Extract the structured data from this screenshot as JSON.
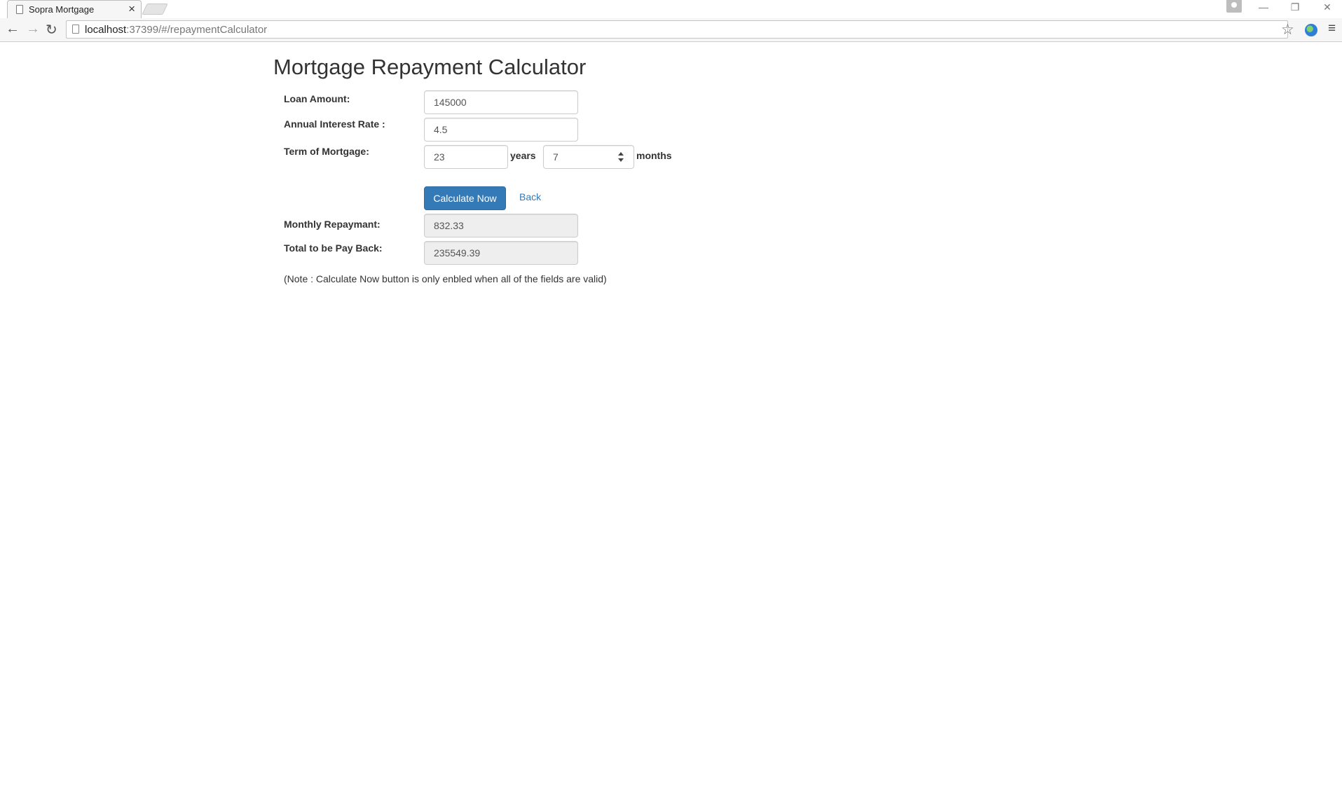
{
  "browser": {
    "tab_title": "Sopra Mortgage",
    "tab_close": "×",
    "url_host": "localhost",
    "url_rest": ":37399/#/repaymentCalculator",
    "window_controls": {
      "minimize": "—",
      "restore": "❐",
      "close": "✕"
    },
    "nav": {
      "back": "←",
      "forward": "→",
      "reload": "↻",
      "star": "☆",
      "menu": "≡"
    }
  },
  "page": {
    "title": "Mortgage Repayment Calculator",
    "loan_amount": {
      "label": "Loan Amount:",
      "value": "145000"
    },
    "interest_rate": {
      "label": "Annual Interest Rate :",
      "value": "4.5"
    },
    "term": {
      "label": "Term of Mortgage:",
      "years_value": "23",
      "years_unit": "years",
      "months_value": "7",
      "months_unit": "months"
    },
    "calculate_button": "Calculate Now",
    "back_link": "Back",
    "monthly_repayment": {
      "label": "Monthly Repaymant:",
      "value": "832.33"
    },
    "total_payback": {
      "label": "Total to be Pay Back:",
      "value": "235549.39"
    },
    "note": "(Note : Calculate Now button is only enbled when all of the fields are valid)"
  },
  "colors": {
    "primary_button": "#337ab7",
    "link": "#337ab7",
    "readonly_field": "#eeeeee"
  }
}
